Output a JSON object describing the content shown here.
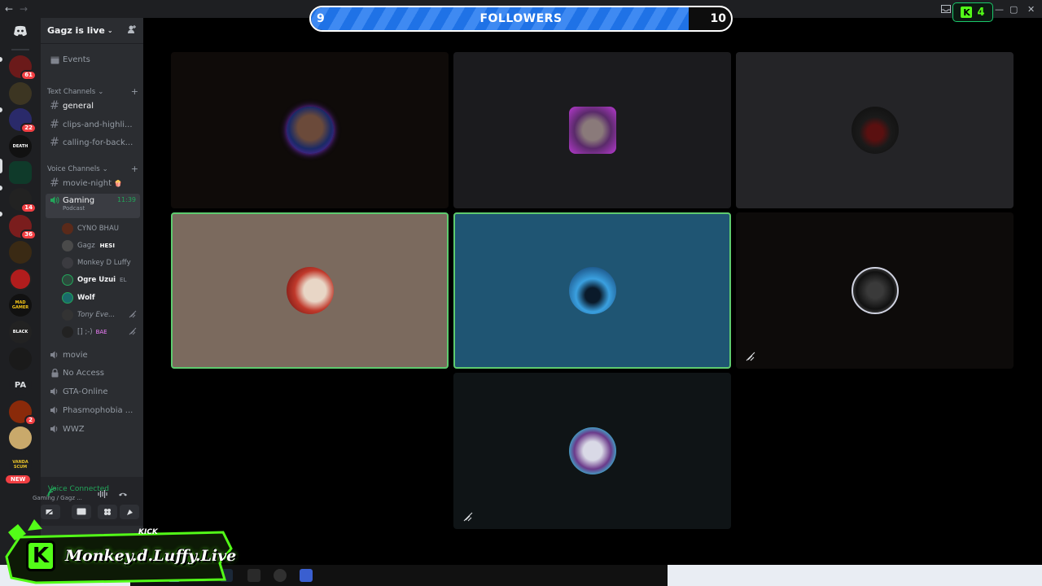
{
  "server": {
    "name": "Gagz is live"
  },
  "sidebar": {
    "events_label": "Events",
    "text_category": "Text Channels",
    "voice_category": "Voice Channels",
    "text_channels": [
      "general",
      "clips-and-highli...",
      "calling-for-back..."
    ],
    "voice_channels_top": [
      "movie-night"
    ],
    "active_voice": {
      "name": "Gaming",
      "subtitle": "Podcast",
      "timer": "11:39"
    },
    "members": [
      "CYNO BHAU",
      "Gagz",
      "Monkey D Luffy",
      "Ogre Uzui",
      "Wolf",
      "Tony Eve...",
      "[] ;-)"
    ],
    "member_tags": {
      "gagz": "HESI",
      "ogre": "EL",
      "last": "BAE"
    },
    "voice_channels_bottom": [
      "movie",
      "No Access",
      "GTA-Online",
      "Phasmophobia ...",
      "WWZ"
    ]
  },
  "rail": {
    "badges": [
      "61",
      "22",
      "14",
      "36",
      "2"
    ],
    "pa_label": "PA",
    "new_label": "NEW",
    "server_words": [
      "DEATH",
      "MAD GAMER",
      "BLACK",
      "VANDA SCUM"
    ]
  },
  "voice_panel": {
    "status": "Voice Connected",
    "location": "Gaming",
    "location_detail": "/ Gagz ..."
  },
  "followers_bar": {
    "current": "9",
    "label": "FOLLOWERS",
    "goal": "10",
    "progress": 0.9
  },
  "kick_badge": {
    "letter": "K",
    "count": "4"
  },
  "overlay": {
    "brand": "KICK",
    "channel": "Monkey.d.Luffy.Live",
    "letter": "K"
  },
  "colors": {
    "speaking": "#5ecb6f",
    "blurple": "#5865f2",
    "followers_fill": "#1f72e6",
    "kick_green": "#53fc18"
  }
}
